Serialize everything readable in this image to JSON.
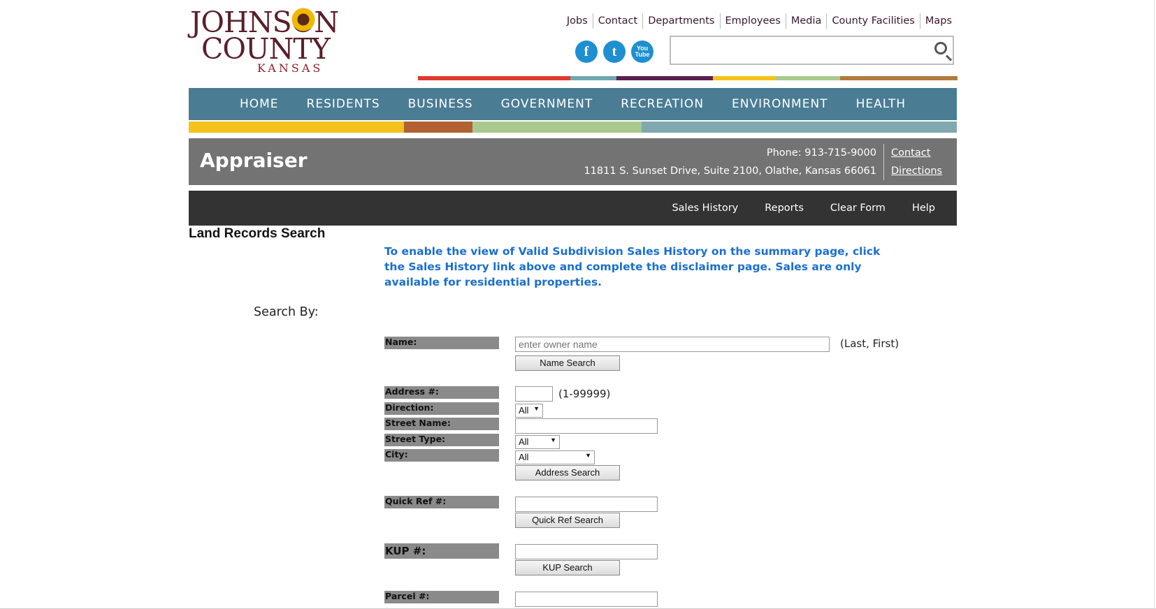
{
  "logo": {
    "line1": "JOHNSON",
    "line2": "COUNTY",
    "line3": "KANSAS"
  },
  "toplinks": [
    "Jobs",
    "Contact",
    "Departments",
    "Employees",
    "Media",
    "County Facilities",
    "Maps"
  ],
  "social": {
    "facebook": "f",
    "twitter": "t",
    "youtube": "You Tube"
  },
  "mainnav": [
    "HOME",
    "RESIDENTS",
    "BUSINESS",
    "GOVERNMENT",
    "RECREATION",
    "ENVIRONMENT",
    "HEALTH"
  ],
  "department": {
    "title": "Appraiser",
    "phone": "Phone: 913-715-9000",
    "address": "11811 S. Sunset Drive, Suite 2100, Olathe, Kansas 66061",
    "contact_link": "Contact",
    "directions_link": "Directions"
  },
  "subnav": [
    "Sales History",
    "Reports",
    "Clear Form",
    "Help"
  ],
  "page": {
    "heading": "Land Records Search",
    "notice": "To enable the view of Valid Subdivision Sales History on the summary page, click the Sales History link above and complete the disclaimer page. Sales are only available for residential properties.",
    "search_by": "Search By:"
  },
  "form": {
    "name_label": "Name:",
    "name_placeholder": "enter owner name",
    "name_hint": "(Last, First)",
    "name_button": "Name Search",
    "address_no_label": "Address #:",
    "address_no_hint": "(1-99999)",
    "direction_label": "Direction:",
    "direction_value": "All",
    "street_name_label": "Street Name:",
    "street_type_label": "Street Type:",
    "street_type_value": "All",
    "city_label": "City:",
    "city_value": "All",
    "address_button": "Address Search",
    "quickref_label": "Quick Ref #:",
    "quickref_button": "Quick Ref Search",
    "kup_label": "KUP #:",
    "kup_button": "KUP Search",
    "parcel_label": "Parcel #:"
  },
  "colors": {
    "nav_bg": "#4a7c94",
    "dept_bg": "#737373",
    "subnav_bg": "#333333",
    "notice": "#1a6fd0",
    "stripe_top": [
      "#e03a2c",
      "#6fa8b0",
      "#5a1f50",
      "#f3c21c",
      "#a9c98e",
      "#b27a3e"
    ],
    "stripe_nav": [
      "#f3c21c",
      "#b26232",
      "#a9c98e",
      "#7fa8b0"
    ]
  }
}
